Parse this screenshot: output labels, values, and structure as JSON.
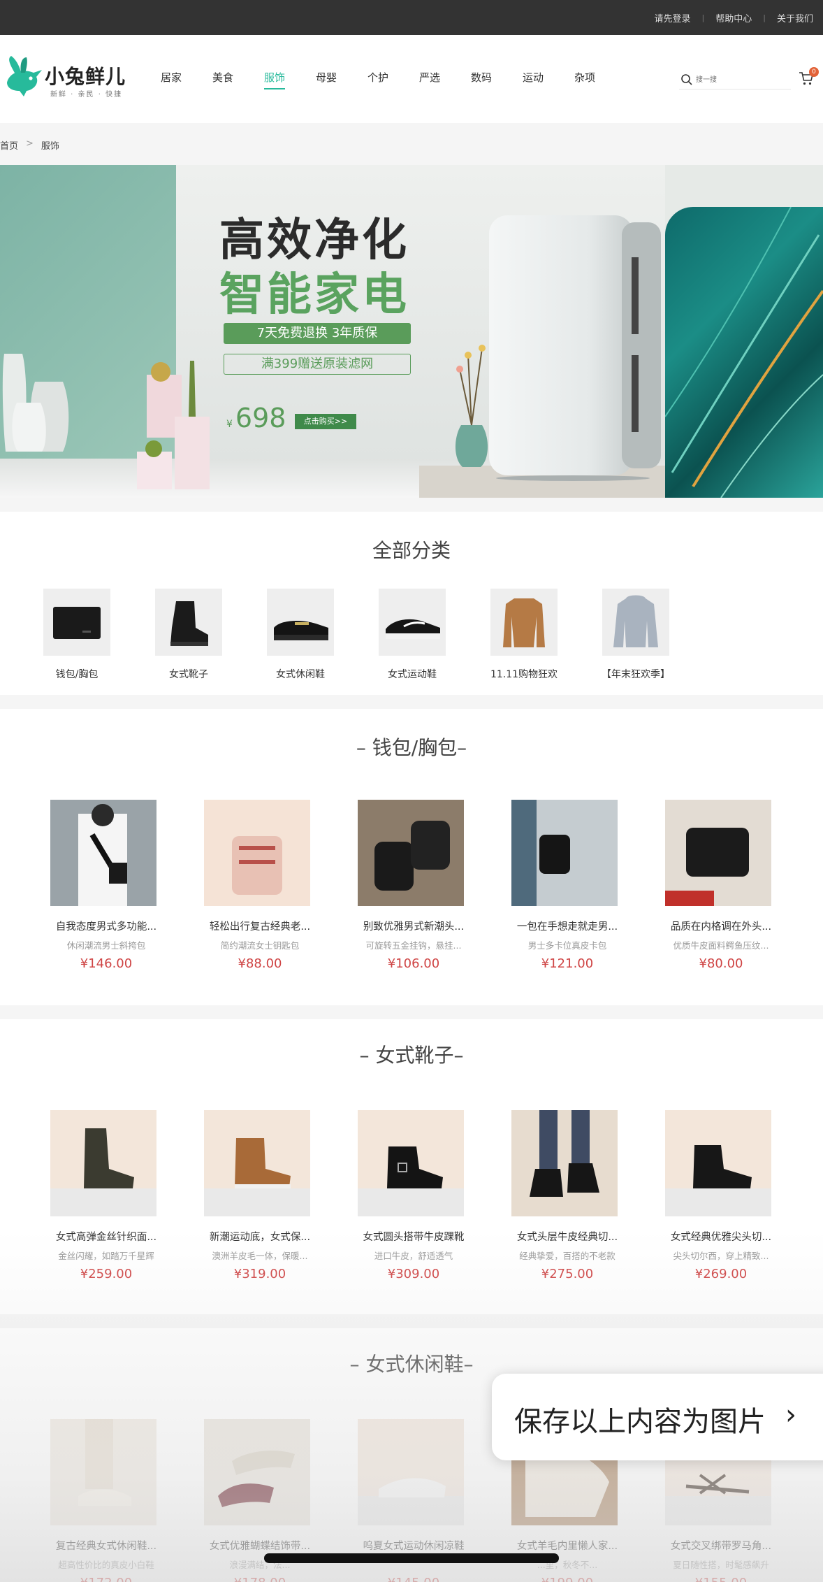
{
  "topbar": {
    "login": "请先登录",
    "help": "帮助中心",
    "about": "关于我们",
    "sep": "|"
  },
  "header": {
    "logo_name": "小兔鲜儿",
    "logo_slogan": "新鲜 · 亲民 · 快捷",
    "nav": [
      "居家",
      "美食",
      "服饰",
      "母婴",
      "个护",
      "严选",
      "数码",
      "运动",
      "杂项"
    ],
    "active_nav": "服饰",
    "search_placeholder": "搜一搜",
    "cart_count": "0"
  },
  "breadcrumb": {
    "home": "首页",
    "sep": ">",
    "current": "服饰"
  },
  "banner": {
    "title1": "高效净化",
    "title2": "智能家电",
    "tag1": "7天免费退换 3年质保",
    "tag2": "满399赠送原装滤网",
    "price_symbol": "¥",
    "price": "698",
    "buy": "点击购买>>"
  },
  "categories": {
    "title": "全部分类",
    "items": [
      {
        "label": "钱包/胸包"
      },
      {
        "label": "女式靴子"
      },
      {
        "label": "女式休闲鞋"
      },
      {
        "label": "女式运动鞋"
      },
      {
        "label": "11.11购物狂欢"
      },
      {
        "label": "【年末狂欢季】"
      }
    ]
  },
  "sections": [
    {
      "title": "– 钱包/胸包–",
      "products": [
        {
          "name": "自我态度男式多功能...",
          "desc": "休闲潮流男士斜挎包",
          "price": "¥146.00"
        },
        {
          "name": "轻松出行复古经典老...",
          "desc": "简约潮流女士钥匙包",
          "price": "¥88.00"
        },
        {
          "name": "别致优雅男式新潮头...",
          "desc": "可旋转五金挂钩，悬挂...",
          "price": "¥106.00"
        },
        {
          "name": "一包在手想走就走男...",
          "desc": "男士多卡位真皮卡包",
          "price": "¥121.00"
        },
        {
          "name": "品质在内格调在外头...",
          "desc": "优质牛皮面料鳄鱼压纹...",
          "price": "¥80.00"
        }
      ]
    },
    {
      "title": "– 女式靴子–",
      "products": [
        {
          "name": "女式高弹金丝针织面...",
          "desc": "金丝闪耀，如踏万千星辉",
          "price": "¥259.00"
        },
        {
          "name": "新潮运动底，女式保...",
          "desc": "澳洲羊皮毛一体，保暖...",
          "price": "¥319.00"
        },
        {
          "name": "女式圆头搭带牛皮踝靴",
          "desc": "进口牛皮，舒适透气",
          "price": "¥309.00"
        },
        {
          "name": "女式头层牛皮经典切...",
          "desc": "经典挚爱，百搭的不老款",
          "price": "¥275.00"
        },
        {
          "name": "女式经典优雅尖头切...",
          "desc": "尖头切尔西，穿上精致...",
          "price": "¥269.00"
        }
      ]
    },
    {
      "title": "– 女式休闲鞋–",
      "products": [
        {
          "name": "复古经典女式休闲鞋...",
          "desc": "超高性价比的真皮小白鞋",
          "price": "¥172.00"
        },
        {
          "name": "女式优雅蝴蝶结饰带...",
          "desc": "浪漫满结，法...",
          "price": "¥178.00"
        },
        {
          "name": "呜夏女式运动休闲凉鞋",
          "desc": "",
          "price": "¥145.00"
        },
        {
          "name": "女式羊毛内里懒人家...",
          "desc": "...里，秋冬不...",
          "price": "¥199.00"
        },
        {
          "name": "女式交叉绑带罗马角...",
          "desc": "夏日随性搭，时髦感飙升",
          "price": "¥155.00"
        }
      ]
    }
  ],
  "overlay": {
    "save_label": "保存以上内容为图片",
    "chevron": "›"
  },
  "colors": {
    "brand": "#27ba9b",
    "price": "#cf4444",
    "topbar": "#333333",
    "banner_green": "#5a9c5a"
  }
}
